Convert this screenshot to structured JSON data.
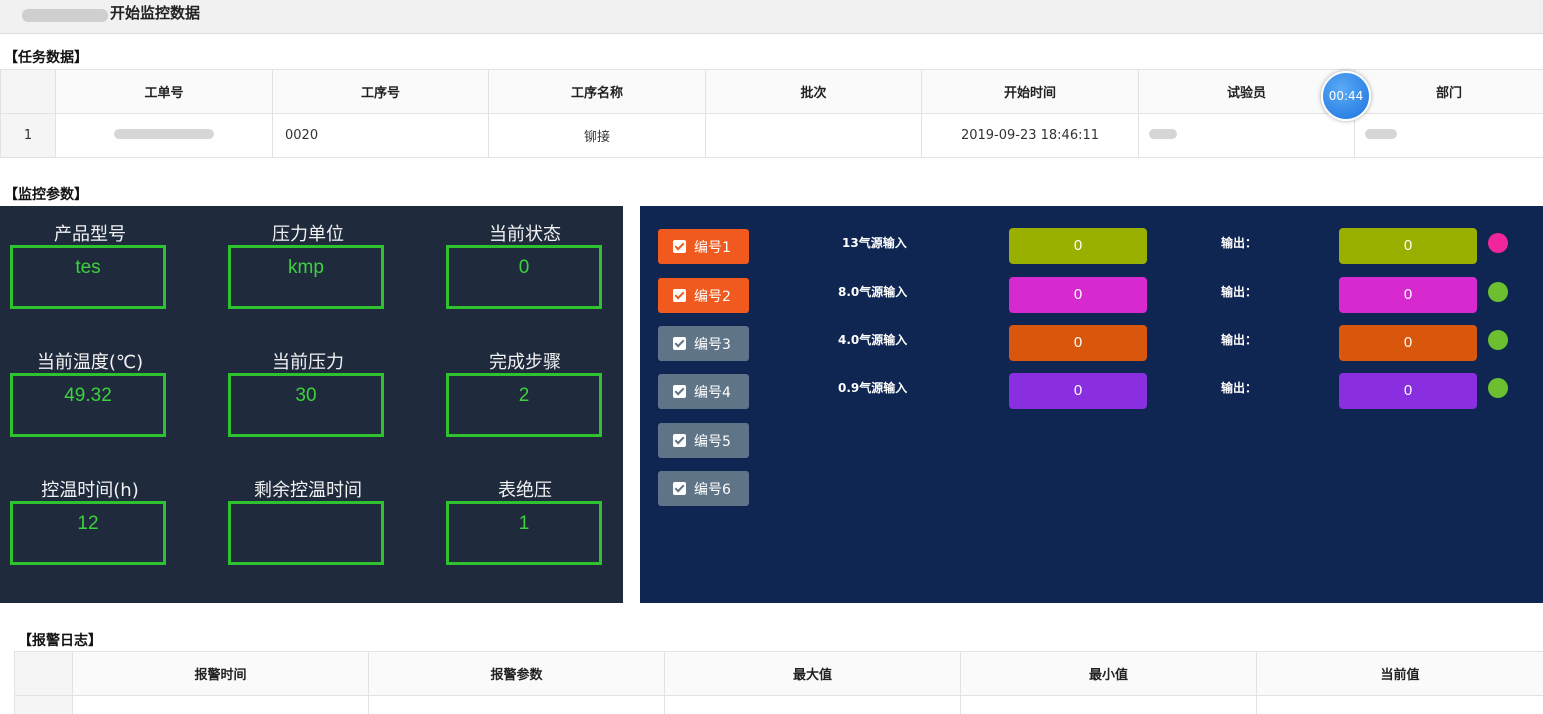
{
  "title": "开始监控数据",
  "task_section": "【任务数据】",
  "task_table": {
    "headers": [
      "工单号",
      "工序号",
      "工序名称",
      "批次",
      "开始时间",
      "试验员",
      "部门"
    ],
    "row": {
      "num": "1",
      "process_no": "0020",
      "process_name": "铆接",
      "batch": "",
      "start_time": "2019-09-23 18:46:11"
    }
  },
  "timer": "00:44",
  "monitor_section": "【监控参数】",
  "params": [
    {
      "label": "产品型号",
      "value": "tes"
    },
    {
      "label": "压力单位",
      "value": "kmp"
    },
    {
      "label": "当前状态",
      "value": "0"
    },
    {
      "label": "当前温度(℃)",
      "value": "49.32"
    },
    {
      "label": "当前压力",
      "value": "30"
    },
    {
      "label": "完成步骤",
      "value": "2"
    },
    {
      "label": "控温时间(h)",
      "value": "12"
    },
    {
      "label": "剩余控温时间",
      "value": ""
    },
    {
      "label": "表绝压",
      "value": "1"
    }
  ],
  "channels": [
    {
      "label": "编号1",
      "checked_style": "active"
    },
    {
      "label": "编号2",
      "checked_style": "active"
    },
    {
      "label": "编号3",
      "checked_style": "inactive"
    },
    {
      "label": "编号4",
      "checked_style": "inactive"
    },
    {
      "label": "编号5",
      "checked_style": "inactive"
    },
    {
      "label": "编号6",
      "checked_style": "inactive"
    }
  ],
  "sources": [
    {
      "label": "13气源输入",
      "input": "0",
      "output_label": "输出：",
      "output": "0",
      "color": "#99b000",
      "dot": "#f0269a"
    },
    {
      "label": "8.0气源输入",
      "input": "0",
      "output_label": "输出：",
      "output": "0",
      "color": "#d62ad0",
      "dot": "#6cbf2e"
    },
    {
      "label": "4.0气源输入",
      "input": "0",
      "output_label": "输出：",
      "output": "0",
      "color": "#d9560d",
      "dot": "#6cbf2e"
    },
    {
      "label": "0.9气源输入",
      "input": "0",
      "output_label": "输出：",
      "output": "0",
      "color": "#8a2fe0",
      "dot": "#6cbf2e"
    }
  ],
  "alarm_section": "【报警日志】",
  "alarm_table": {
    "headers": [
      "报警时间",
      "报警参数",
      "最大值",
      "最小值",
      "当前值"
    ]
  },
  "colors": {
    "active_tab": "#f05a1e",
    "inactive_tab": "#5f7486",
    "param_border": "#2ec22e",
    "left_panel": "#1f2b3d",
    "right_panel": "#0f2552"
  }
}
